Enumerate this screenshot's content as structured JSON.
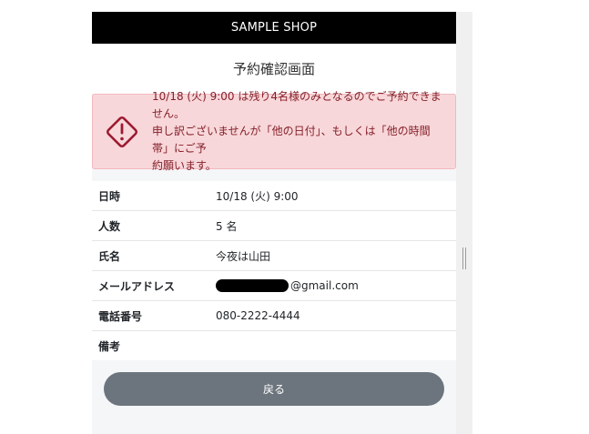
{
  "header": {
    "shop_name": "SAMPLE SHOP"
  },
  "page": {
    "title": "予約確認画面"
  },
  "alert": {
    "icon": "warning-diamond-icon",
    "line1": "10/18 (火) 9:00 は残り4名様のみとなるのでご予約できません。",
    "line2": "申し訳ございませんが「他の日付」、もしくは「他の時間帯」にご予",
    "line3": "約願います。",
    "colors": {
      "background": "#f8d7da",
      "text": "#842029",
      "icon": "#9b1b30"
    }
  },
  "details": {
    "rows": [
      {
        "label": "日時",
        "value": "10/18 (火) 9:00"
      },
      {
        "label": "人数",
        "value": "5 名"
      },
      {
        "label": "氏名",
        "value": "今夜は山田"
      },
      {
        "label": "メールアドレス",
        "value": "@gmail.com"
      },
      {
        "label": "電話番号",
        "value": "080-2222-4444"
      },
      {
        "label": "備考",
        "value": ""
      }
    ]
  },
  "actions": {
    "back_label": "戻る"
  }
}
